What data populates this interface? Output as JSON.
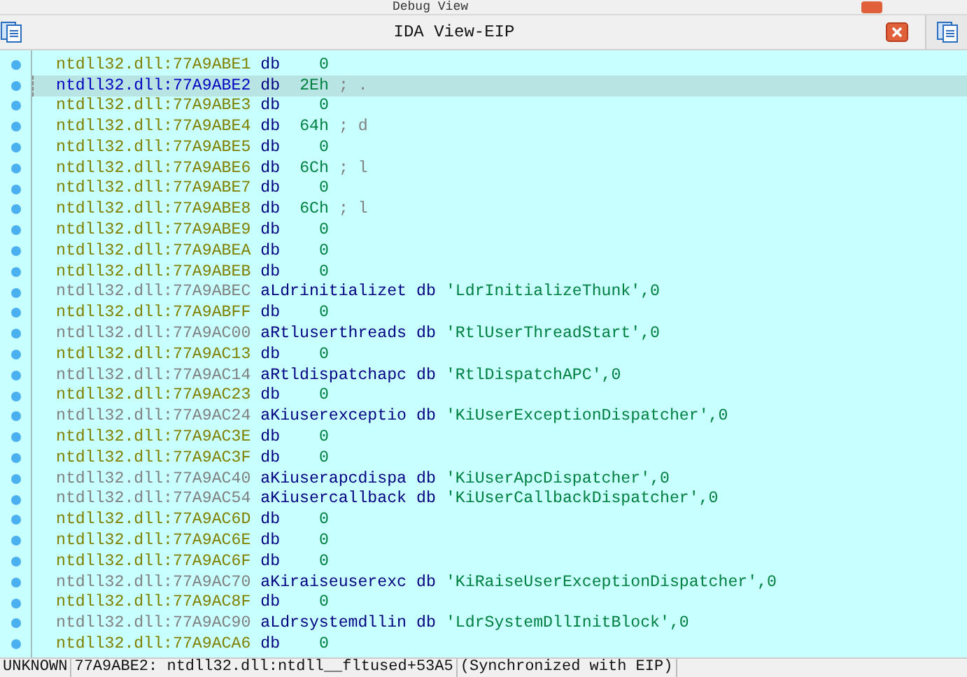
{
  "debug_view": {
    "title": "Debug View"
  },
  "window": {
    "title": "IDA View-EIP"
  },
  "lines": [
    {
      "kind": "byte",
      "address": "ntdll32.dll:77A9ABE1",
      "directive": "db",
      "value": "0",
      "selected": false
    },
    {
      "kind": "byte",
      "address": "ntdll32.dll:77A9ABE2",
      "directive": "db",
      "value": "2Eh",
      "comment": "; .",
      "selected": true
    },
    {
      "kind": "byte",
      "address": "ntdll32.dll:77A9ABE3",
      "directive": "db",
      "value": "0",
      "selected": false
    },
    {
      "kind": "byte",
      "address": "ntdll32.dll:77A9ABE4",
      "directive": "db",
      "value": "64h",
      "comment": "; d",
      "selected": false
    },
    {
      "kind": "byte",
      "address": "ntdll32.dll:77A9ABE5",
      "directive": "db",
      "value": "0",
      "selected": false
    },
    {
      "kind": "byte",
      "address": "ntdll32.dll:77A9ABE6",
      "directive": "db",
      "value": "6Ch",
      "comment": "; l",
      "selected": false
    },
    {
      "kind": "byte",
      "address": "ntdll32.dll:77A9ABE7",
      "directive": "db",
      "value": "0",
      "selected": false
    },
    {
      "kind": "byte",
      "address": "ntdll32.dll:77A9ABE8",
      "directive": "db",
      "value": "6Ch",
      "comment": "; l",
      "selected": false
    },
    {
      "kind": "byte",
      "address": "ntdll32.dll:77A9ABE9",
      "directive": "db",
      "value": "0",
      "selected": false
    },
    {
      "kind": "byte",
      "address": "ntdll32.dll:77A9ABEA",
      "directive": "db",
      "value": "0",
      "selected": false
    },
    {
      "kind": "byte",
      "address": "ntdll32.dll:77A9ABEB",
      "directive": "db",
      "value": "0",
      "selected": false
    },
    {
      "kind": "string",
      "address": "ntdll32.dll:77A9ABEC",
      "label": "aLdrinitializet",
      "directive": "db",
      "value": "'LdrInitializeThunk',0",
      "selected": false
    },
    {
      "kind": "byte",
      "address": "ntdll32.dll:77A9ABFF",
      "directive": "db",
      "value": "0",
      "selected": false
    },
    {
      "kind": "string",
      "address": "ntdll32.dll:77A9AC00",
      "label": "aRtluserthreads",
      "directive": "db",
      "value": "'RtlUserThreadStart',0",
      "selected": false
    },
    {
      "kind": "byte",
      "address": "ntdll32.dll:77A9AC13",
      "directive": "db",
      "value": "0",
      "selected": false
    },
    {
      "kind": "string",
      "address": "ntdll32.dll:77A9AC14",
      "label": "aRtldispatchapc",
      "directive": "db",
      "value": "'RtlDispatchAPC',0",
      "selected": false
    },
    {
      "kind": "byte",
      "address": "ntdll32.dll:77A9AC23",
      "directive": "db",
      "value": "0",
      "selected": false
    },
    {
      "kind": "string",
      "address": "ntdll32.dll:77A9AC24",
      "label": "aKiuserexceptio",
      "directive": "db",
      "value": "'KiUserExceptionDispatcher',0",
      "selected": false
    },
    {
      "kind": "byte",
      "address": "ntdll32.dll:77A9AC3E",
      "directive": "db",
      "value": "0",
      "selected": false
    },
    {
      "kind": "byte",
      "address": "ntdll32.dll:77A9AC3F",
      "directive": "db",
      "value": "0",
      "selected": false
    },
    {
      "kind": "string",
      "address": "ntdll32.dll:77A9AC40",
      "label": "aKiuserapcdispa",
      "directive": "db",
      "value": "'KiUserApcDispatcher',0",
      "selected": false
    },
    {
      "kind": "string",
      "address": "ntdll32.dll:77A9AC54",
      "label": "aKiusercallback",
      "directive": "db",
      "value": "'KiUserCallbackDispatcher',0",
      "selected": false
    },
    {
      "kind": "byte",
      "address": "ntdll32.dll:77A9AC6D",
      "directive": "db",
      "value": "0",
      "selected": false
    },
    {
      "kind": "byte",
      "address": "ntdll32.dll:77A9AC6E",
      "directive": "db",
      "value": "0",
      "selected": false
    },
    {
      "kind": "byte",
      "address": "ntdll32.dll:77A9AC6F",
      "directive": "db",
      "value": "0",
      "selected": false
    },
    {
      "kind": "string",
      "address": "ntdll32.dll:77A9AC70",
      "label": "aKiraiseuserexc",
      "directive": "db",
      "value": "'KiRaiseUserExceptionDispatcher',0",
      "selected": false
    },
    {
      "kind": "byte",
      "address": "ntdll32.dll:77A9AC8F",
      "directive": "db",
      "value": "0",
      "selected": false
    },
    {
      "kind": "string",
      "address": "ntdll32.dll:77A9AC90",
      "label": "aLdrsystemdllin",
      "directive": "db",
      "value": "'LdrSystemDllInitBlock',0",
      "selected": false
    },
    {
      "kind": "byte",
      "address": "ntdll32.dll:77A9ACA6",
      "directive": "db",
      "value": "0",
      "selected": false
    }
  ],
  "status_bar": [
    "UNKNOWN",
    "77A9ABE2: ntdll32.dll:ntdll__fltused+53A5",
    "(Synchronized with EIP)"
  ]
}
